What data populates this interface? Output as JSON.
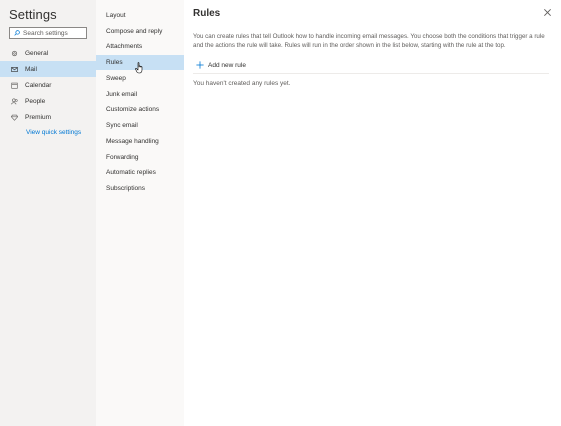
{
  "nav": {
    "title": "Settings",
    "search_placeholder": "Search settings",
    "items": [
      {
        "label": "General",
        "icon": "gear-icon"
      },
      {
        "label": "Mail",
        "icon": "mail-icon"
      },
      {
        "label": "Calendar",
        "icon": "calendar-icon"
      },
      {
        "label": "People",
        "icon": "people-icon"
      },
      {
        "label": "Premium",
        "icon": "diamond-icon"
      }
    ],
    "selected": "Mail",
    "quick_settings_link": "View quick settings"
  },
  "mail_settings": {
    "items": [
      "Layout",
      "Compose and reply",
      "Attachments",
      "Rules",
      "Sweep",
      "Junk email",
      "Customize actions",
      "Sync email",
      "Message handling",
      "Forwarding",
      "Automatic replies",
      "Subscriptions"
    ],
    "selected": "Rules"
  },
  "main": {
    "title": "Rules",
    "description": "You can create rules that tell Outlook how to handle incoming email messages. You choose both the conditions that trigger a rule and the actions the rule will take. Rules will run in the order shown in the list below, starting with the rule at the top.",
    "add_rule_label": "Add new rule",
    "empty_message": "You haven't created any rules yet."
  },
  "colors": {
    "accent": "#0078d4",
    "selected_bg": "#c7e0f4",
    "nav_bg": "#f3f2f1"
  }
}
